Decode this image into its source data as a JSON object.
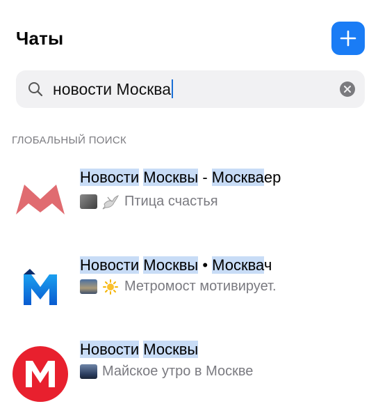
{
  "header": {
    "title": "Чаты"
  },
  "search": {
    "query": "новости Москва"
  },
  "section": {
    "label": "ГЛОБАЛЬНЫЙ ПОИСК"
  },
  "results": [
    {
      "name_parts": [
        {
          "text": "Новости",
          "hl": true
        },
        {
          "text": " ",
          "hl": false
        },
        {
          "text": "Москвы",
          "hl": true
        },
        {
          "text": " - ",
          "hl": false
        },
        {
          "text": "Москва",
          "hl": true
        },
        {
          "text": "ер",
          "hl": false
        }
      ],
      "preview": "Птица счастья"
    },
    {
      "name_parts": [
        {
          "text": "Новости",
          "hl": true
        },
        {
          "text": " ",
          "hl": false
        },
        {
          "text": "Москвы",
          "hl": true
        },
        {
          "text": " • ",
          "hl": false
        },
        {
          "text": "Москва",
          "hl": true
        },
        {
          "text": "ч",
          "hl": false
        }
      ],
      "preview": "Метромост мотивирует."
    },
    {
      "name_parts": [
        {
          "text": "Новости",
          "hl": true
        },
        {
          "text": " ",
          "hl": false
        },
        {
          "text": "Москвы",
          "hl": true
        }
      ],
      "preview": "Майское утро в Москве"
    }
  ],
  "colors": {
    "accent": "#1a7cf5",
    "highlight": "#c8dcf6"
  }
}
